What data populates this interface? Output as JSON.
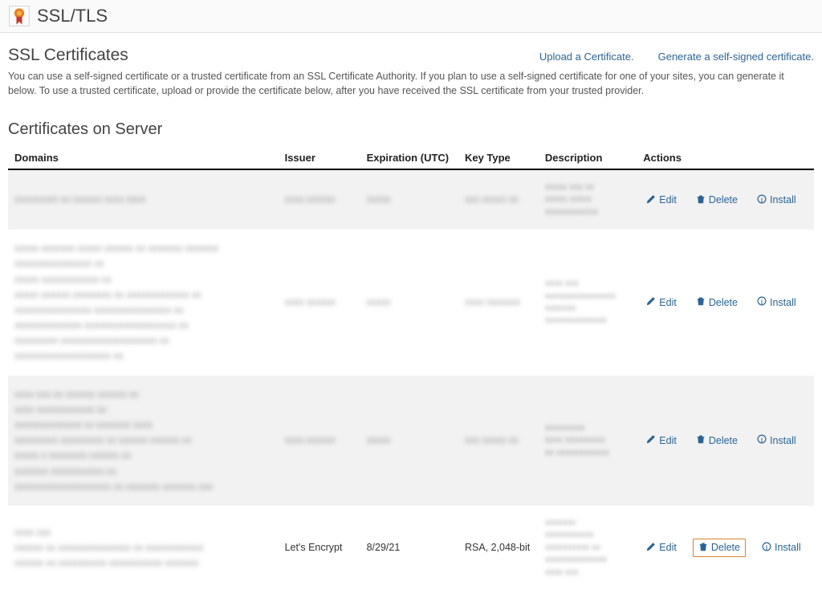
{
  "header": {
    "title": "SSL/TLS"
  },
  "section": {
    "title": "SSL Certificates",
    "links": {
      "upload": "Upload a Certificate.",
      "generate": "Generate a self-signed certificate."
    },
    "intro": "You can use a self-signed certificate or a trusted certificate from an SSL Certificate Authority. If you plan to use a self-signed certificate for one of your sites, you can generate it below. To use a trusted certificate, upload or provide the certificate below, after you have received the SSL certificate from your trusted provider."
  },
  "subsection": {
    "title": "Certificates on Server"
  },
  "table": {
    "headers": {
      "domains": "Domains",
      "issuer": "Issuer",
      "expiration": "Expiration (UTC)",
      "keytype": "Key Type",
      "description": "Description",
      "actions": "Actions"
    },
    "actions": {
      "edit": "Edit",
      "delete": "Delete",
      "install": "Install"
    },
    "rows": [
      {
        "domains_blur": "xxxxxxxxx xx xxxxxx xxxx xxxx",
        "issuer_blur": "xxxx xxxxxx",
        "expiration_blur": "xxxxx",
        "keytype_blur": "xxx xxxxx xx",
        "description_blur": "xxxxx xxx xx\nxxxxx xxxxx\nxxxxxxxxxxxx",
        "highlight_delete": false,
        "alt": true
      },
      {
        "domains_blur": "xxxxx xxxxxxx xxxxx xxxxxx xx xxxxxxx xxxxxxx\nxxxxxxxxxxxxxxxx xx\nxxxxx xxxxxxxxxxxx xx\nxxxxx xxxxxx xxxxxxxx xx xxxxxxxxxxxxx xx\nxxxxxxxxxxxxxxxx xxxxxxxxxxxxxxxx xx\nxxxxxxxxxxxxxx xxxxxxxxxxxxxxxxxxx xx\nxxxxxxxxx xxxxxxxxxxxxxxxxxxxx xx\nxxxxxxxxxxxxxxxxxxxx xx",
        "issuer_blur": "xxxx xxxxxx",
        "expiration_blur": "xxxxx",
        "keytype_blur": "xxxx xxxxxxx",
        "description_blur": "xxxx xxx\nxxxxxxxxxxxxxxxx\nxxxxxxx\nxxxxxxxxxxxxxx",
        "highlight_delete": false,
        "alt": false
      },
      {
        "domains_blur": "xxxx xxx xx xxxxxx xxxxxx xx\nxxxx xxxxxxxxxxxx xx\nxxxxxxxxxxxxxx xx xxxxxxx xxxx\nxxxxxxxxx xxxxxxxxx xx xxxxxx xxxxxx xx\nxxxxx x xxxxxxxx xxxxxx xx\nxxxxxxx xxxxxxxxxxx xx\nxxxxxxxxxxxxxxxxxxxx xx xxxxxxx xxxxxxx xxx",
        "issuer_blur": "xxxx xxxxxx",
        "expiration_blur": "xxxxx",
        "keytype_blur": "xxx xxxxx xx",
        "description_blur": "xxxxxxxxx\nxxxx xxxxxxxxx\nxx xxxxxxxxxxxx",
        "highlight_delete": false,
        "alt": true
      },
      {
        "domains_blur": "xxxx xxx\nxxxxxx xx xxxxxxxxxxxxxxx xx xxxxxxxxxxxx\nxxxxxx xx xxxxxxxxxx xxxxxxxxxxx xxxxxxx",
        "issuer": "Let's Encrypt",
        "expiration": "8/29/21",
        "keytype": "RSA, 2,048-bit",
        "description_blur": "xxxxxxx\nxxxxxxxxxxx\nxxxxxxxxxx xx\nxxxxxxxxxxxxxx\nxxxx xxx",
        "highlight_delete": true,
        "alt": false
      }
    ]
  }
}
